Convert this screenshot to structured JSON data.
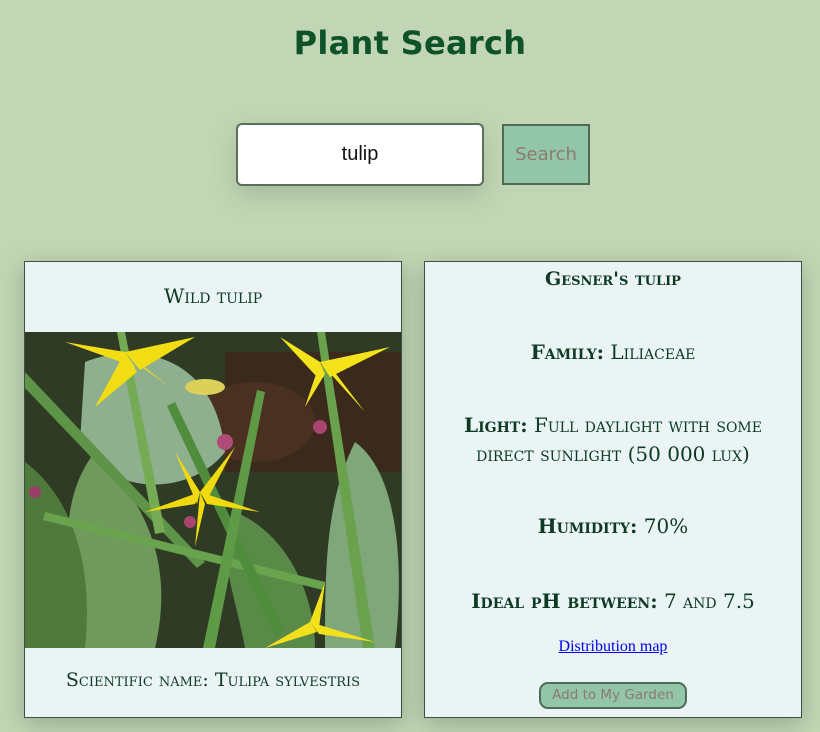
{
  "header": {
    "title": "Plant Search"
  },
  "search": {
    "value": "tulip",
    "button_label": "Search"
  },
  "results": [
    {
      "common_name": "Wild tulip",
      "image_alt": "Yellow wild tulip flowers among green leaves",
      "scientific_label": "Scientific name:",
      "scientific_name": "Tulipa sylvestris"
    },
    {
      "common_name": "Gesner's tulip",
      "family_label": "Family:",
      "family": "Liliaceae",
      "light_label": "Light:",
      "light": "Full daylight with some direct sunlight (50 000 lux)",
      "humidity_label": "Humidity:",
      "humidity": "70%",
      "ph_label": "Ideal pH between:",
      "ph": "7 and 7.5",
      "map_link": "Distribution map",
      "add_button_label": "Add to My Garden"
    }
  ],
  "colors": {
    "background": "#c2d6b5",
    "title": "#0e5229",
    "card_background": "#eaf4f5",
    "button_background": "#93c6a8",
    "button_text": "#8c7a70",
    "link": "#0000ee"
  },
  "icons": {
    "plant_photo": "tulip-photo"
  }
}
